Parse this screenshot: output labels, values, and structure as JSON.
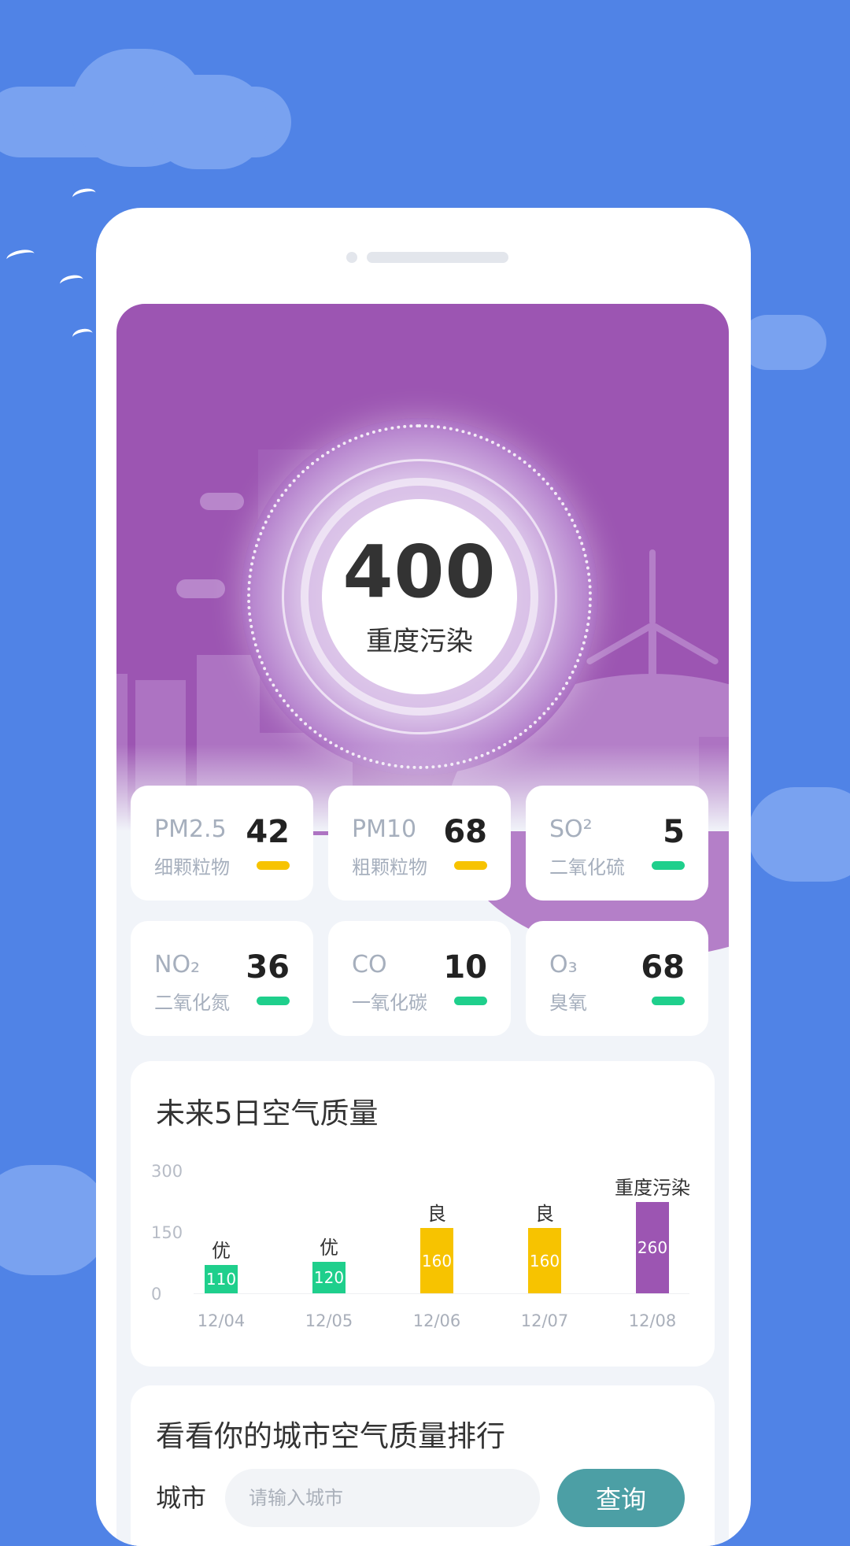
{
  "aqi": {
    "value": "400",
    "level": "重度污染"
  },
  "pollutants": [
    {
      "name": "PM2.5",
      "sub": "细颗粒物",
      "value": "42",
      "status_color": "#f7c300"
    },
    {
      "name": "PM10",
      "sub": "粗颗粒物",
      "value": "68",
      "status_color": "#f7c300"
    },
    {
      "name": "SO²",
      "sub": "二氧化硫",
      "value": "5",
      "status_color": "#1fcf8c"
    },
    {
      "name": "NO₂",
      "sub": "二氧化氮",
      "value": "36",
      "status_color": "#1fcf8c"
    },
    {
      "name": "CO",
      "sub": "一氧化碳",
      "value": "10",
      "status_color": "#1fcf8c"
    },
    {
      "name": "O₃",
      "sub": "臭氧",
      "value": "68",
      "status_color": "#1fcf8c"
    }
  ],
  "forecast": {
    "title": "未来5日空气质量",
    "chart_data": {
      "type": "bar",
      "categories": [
        "12/04",
        "12/05",
        "12/06",
        "12/07",
        "12/08"
      ],
      "values": [
        110,
        120,
        160,
        160,
        260
      ],
      "labels": [
        "优",
        "优",
        "良",
        "良",
        "重度污染"
      ],
      "colors": [
        "#1fcf8c",
        "#1fcf8c",
        "#f7c300",
        "#f7c300",
        "#9c55b2"
      ],
      "yticks": [
        "300",
        "150",
        "0"
      ],
      "ylim": [
        0,
        300
      ]
    }
  },
  "ranking": {
    "title": "看看你的城市空气质量排行",
    "city_label": "城市",
    "input_placeholder": "请输入城市",
    "query_button": "查询"
  },
  "colors": {
    "background": "#5083e6",
    "hero": "#9c55b2",
    "button": "#4c9fa5"
  }
}
